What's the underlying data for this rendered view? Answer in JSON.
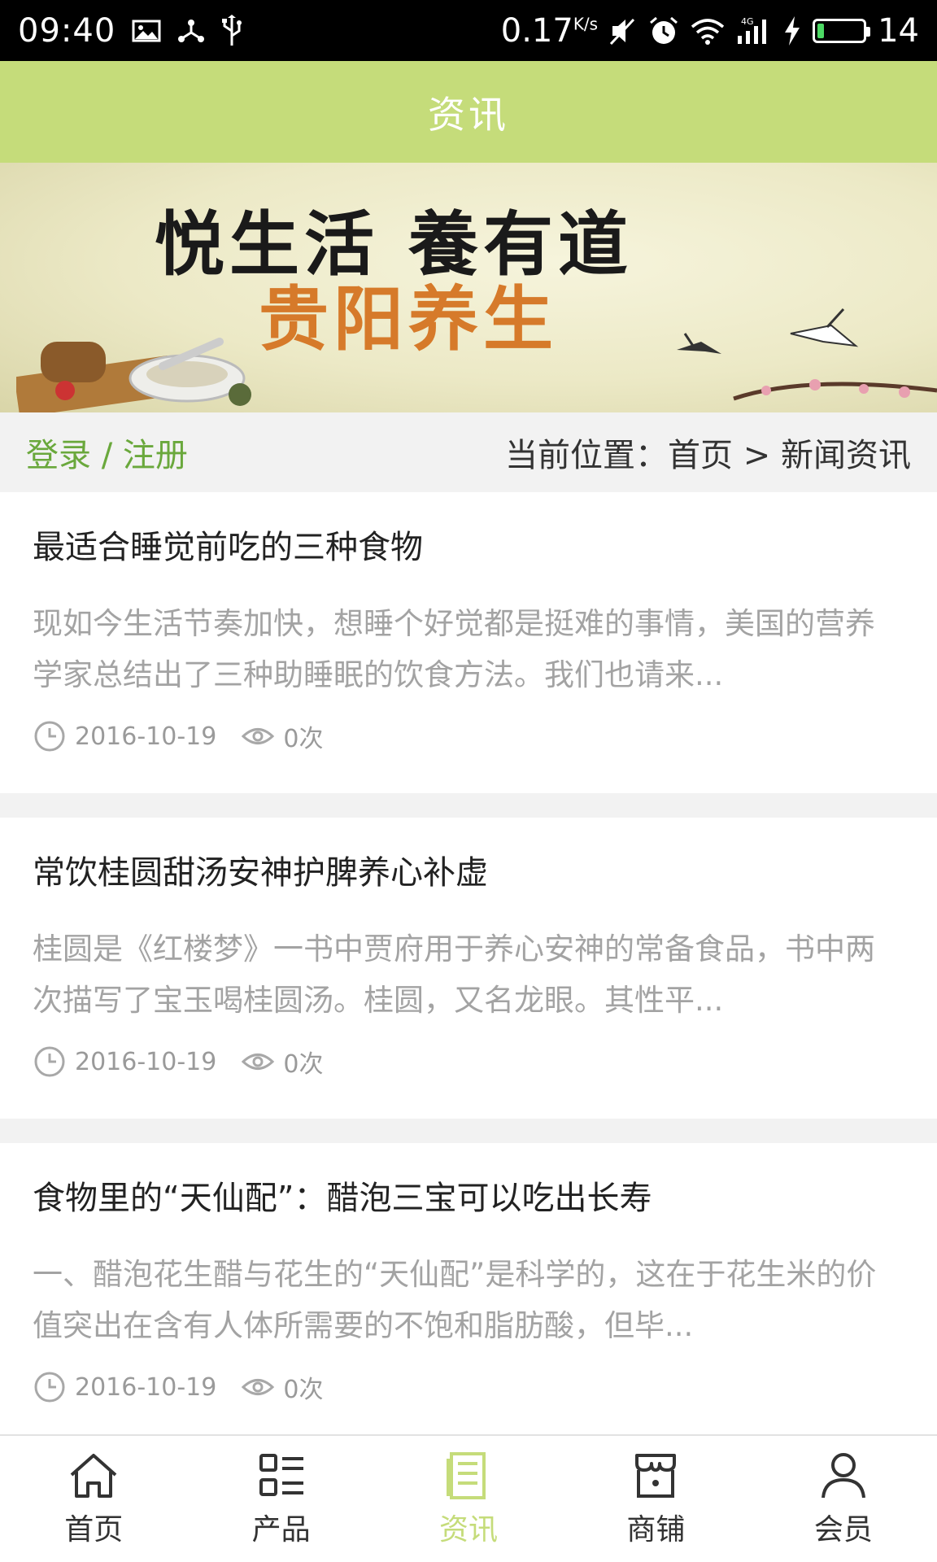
{
  "status_bar": {
    "time": "09:40",
    "speed": "0.17",
    "speed_unit": "K/s",
    "battery_level": "14",
    "icons": [
      "image-icon",
      "usb-share-icon",
      "usb-icon",
      "mute-icon",
      "alarm-icon",
      "wifi-icon",
      "signal-4g-icon",
      "charging-icon",
      "battery-icon"
    ]
  },
  "header": {
    "title": "资讯"
  },
  "banner": {
    "line1": "悦生活  養有道",
    "line2": "贵阳养生"
  },
  "breadcrumb": {
    "login_label": "登录 / 注册",
    "path": "当前位置：首页 > 新闻资讯"
  },
  "news": [
    {
      "title": "最适合睡觉前吃的三种食物",
      "desc": "现如今生活节奏加快，想睡个好觉都是挺难的事情，美国的营养学家总结出了三种助睡眠的饮食方法。我们也请来...",
      "date": "2016-10-19",
      "views": "0次"
    },
    {
      "title": "常饮桂圆甜汤安神护脾养心补虚",
      "desc": "桂圆是《红楼梦》一书中贾府用于养心安神的常备食品，书中两次描写了宝玉喝桂圆汤。桂圆，又名龙眼。其性平...",
      "date": "2016-10-19",
      "views": "0次"
    },
    {
      "title": "食物里的“天仙配”：醋泡三宝可以吃出长寿",
      "desc": "一、醋泡花生醋与花生的“天仙配”是科学的，这在于花生米的价值突出在含有人体所需要的不饱和脂肪酸，但毕...",
      "date": "2016-10-19",
      "views": "0次"
    }
  ],
  "bottom_nav": {
    "items": [
      {
        "label": "首页",
        "icon": "home-icon"
      },
      {
        "label": "产品",
        "icon": "product-grid-icon"
      },
      {
        "label": "资讯",
        "icon": "news-icon",
        "active": true
      },
      {
        "label": "商铺",
        "icon": "shop-icon"
      },
      {
        "label": "会员",
        "icon": "user-icon"
      }
    ]
  },
  "colors": {
    "accent": "#c5dc7a",
    "login_link": "#6aa83c",
    "muted_text": "#a3a3a3"
  }
}
